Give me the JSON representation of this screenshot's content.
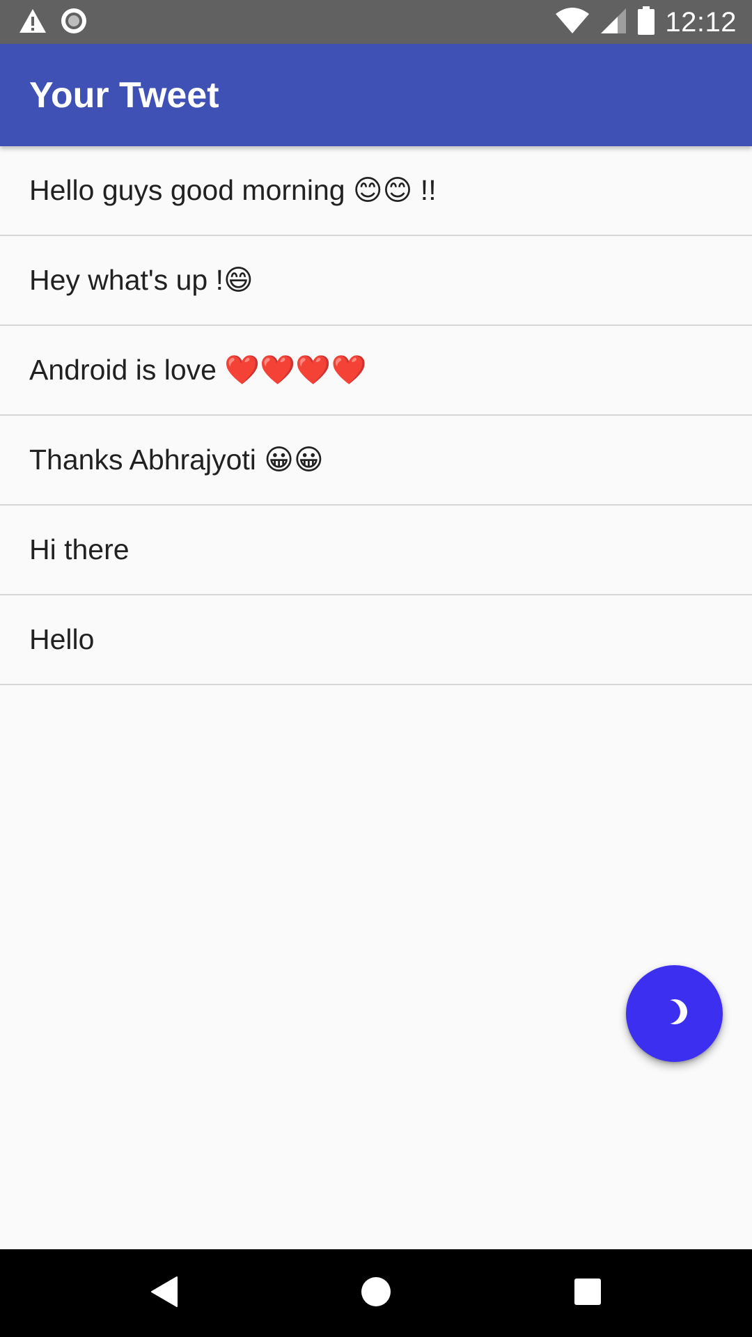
{
  "status_bar": {
    "time": "12:12",
    "icons": [
      "warning-icon",
      "sync-circle-icon",
      "wifi-icon",
      "cell-signal-icon",
      "battery-icon"
    ],
    "background": "#616161"
  },
  "app_bar": {
    "title": "Your Tweet",
    "background": "#3f51b5"
  },
  "tweets": [
    {
      "text": "Hello guys good morning 😊😊 !!"
    },
    {
      "text": "Hey what's up !😄"
    },
    {
      "text": "Android is love ❤️❤️❤️❤️"
    },
    {
      "text": "Thanks Abhrajyoti 😀😀"
    },
    {
      "text": "Hi there"
    },
    {
      "text": "Hello"
    }
  ],
  "fab": {
    "icon": "moon-icon",
    "background": "#3d2ff0"
  },
  "nav_bar": {
    "icons": [
      "back-triangle-icon",
      "home-circle-icon",
      "recents-square-icon"
    ],
    "background": "#000000"
  }
}
